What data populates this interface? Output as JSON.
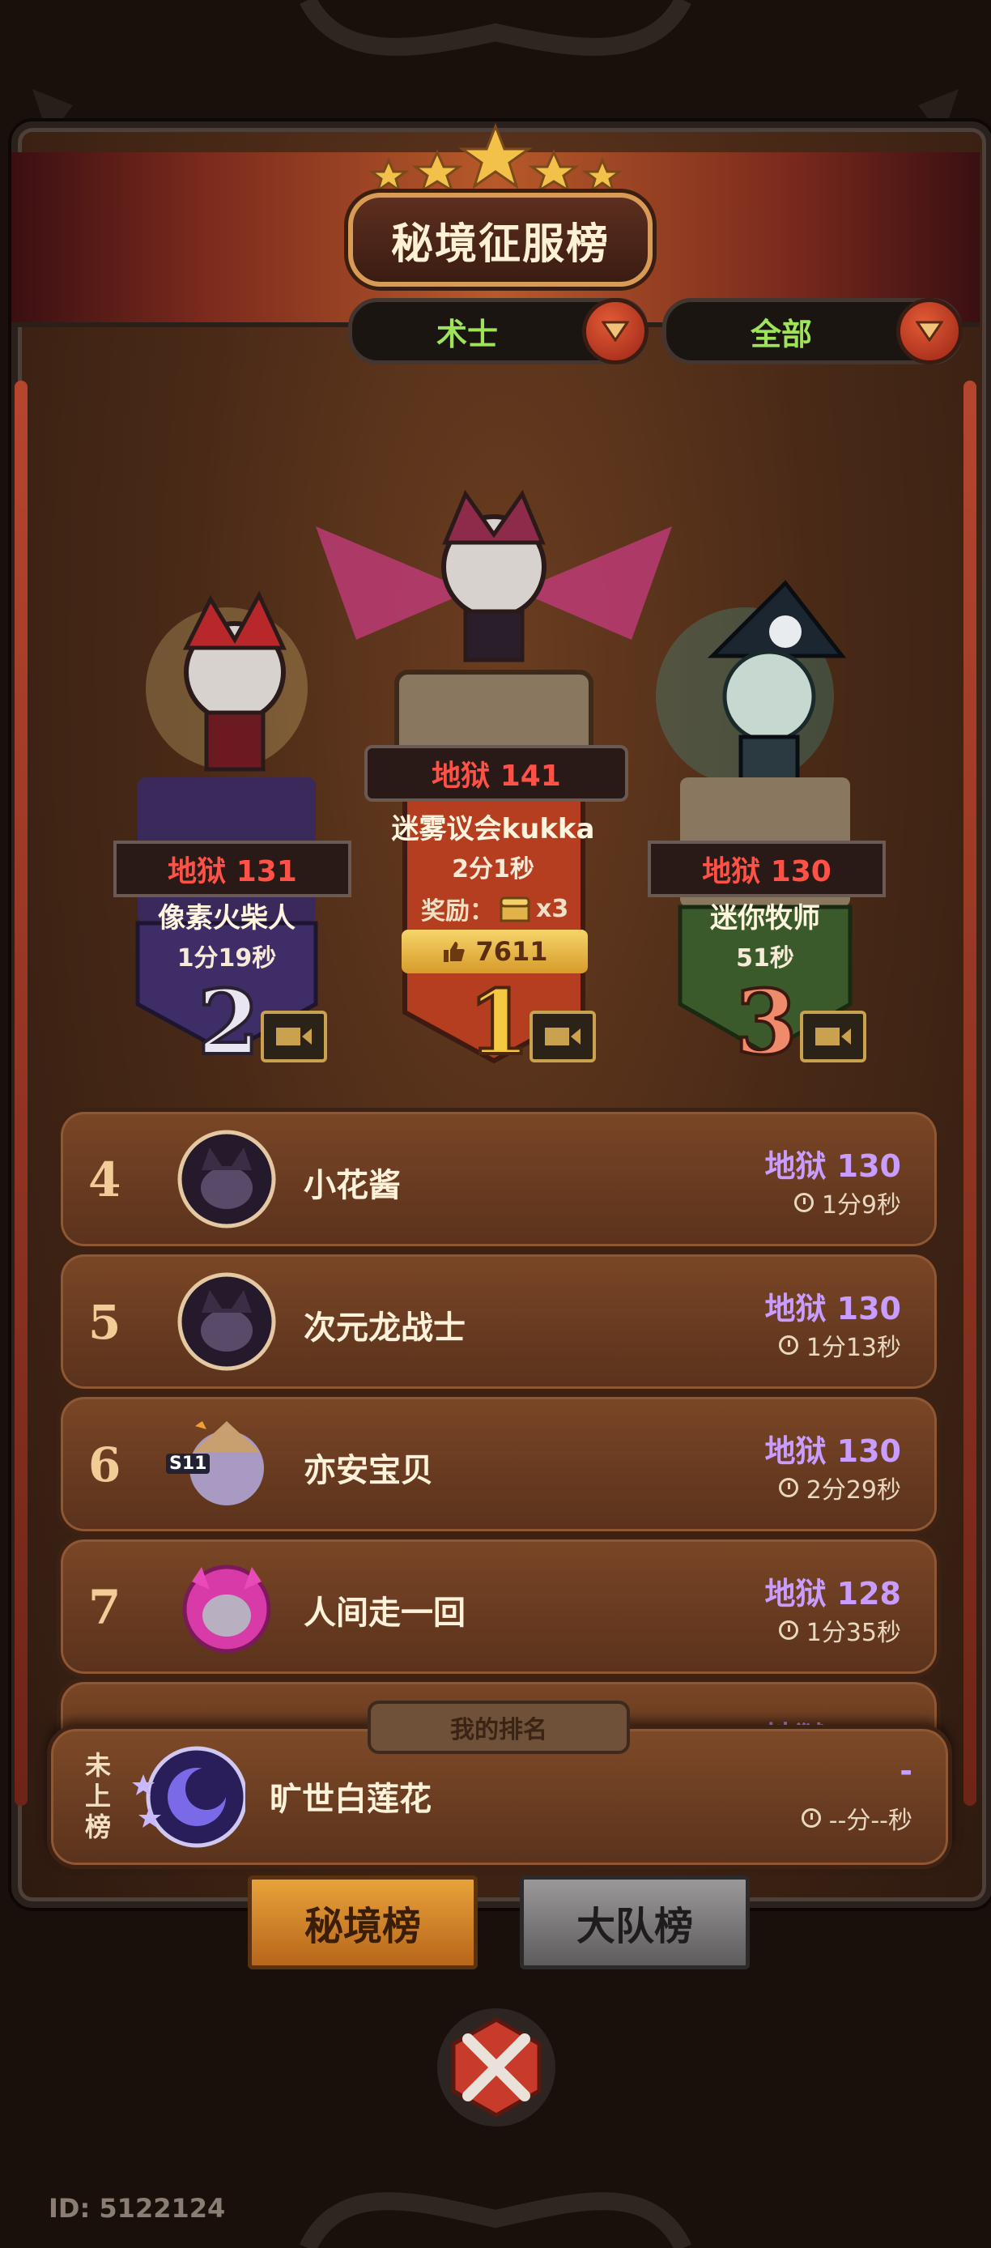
{
  "header": {
    "title": "秘境征服榜"
  },
  "filters": {
    "class_label": "术士",
    "scope_label": "全部"
  },
  "podium": [
    {
      "rank": "1",
      "difficulty": "地狱 141",
      "name": "迷雾议会kukka",
      "time": "2分1秒",
      "reward_label": "奖励：",
      "reward_count": "x3",
      "likes": "7611"
    },
    {
      "rank": "2",
      "difficulty": "地狱 131",
      "name": "像素火柴人",
      "time": "1分19秒"
    },
    {
      "rank": "3",
      "difficulty": "地狱 130",
      "name": "迷你牧师",
      "time": "51秒"
    }
  ],
  "list": [
    {
      "rank": "4",
      "name": "小花酱",
      "score": "地狱 130",
      "time": "1分9秒"
    },
    {
      "rank": "5",
      "name": "次元龙战士",
      "score": "地狱 130",
      "time": "1分13秒"
    },
    {
      "rank": "6",
      "name": "亦安宝贝",
      "score": "地狱 130",
      "time": "2分29秒",
      "badge": "S11"
    },
    {
      "rank": "7",
      "name": "人间走一回",
      "score": "地狱 128",
      "time": "1分35秒"
    },
    {
      "score": "地狱 128"
    }
  ],
  "my_rank": {
    "tag": "我的排名",
    "status": "未上榜",
    "name": "旷世白莲花",
    "score": "-",
    "time": "--分--秒"
  },
  "tabs": [
    {
      "label": "秘境榜"
    },
    {
      "label": "大队榜"
    }
  ],
  "footer": {
    "id_text": "ID: 5122124"
  },
  "colors": {
    "accent_green": "#9ee35a",
    "hell_red": "#ff5146",
    "score_purple": "#c99cff",
    "gold": "#e9b53c"
  }
}
